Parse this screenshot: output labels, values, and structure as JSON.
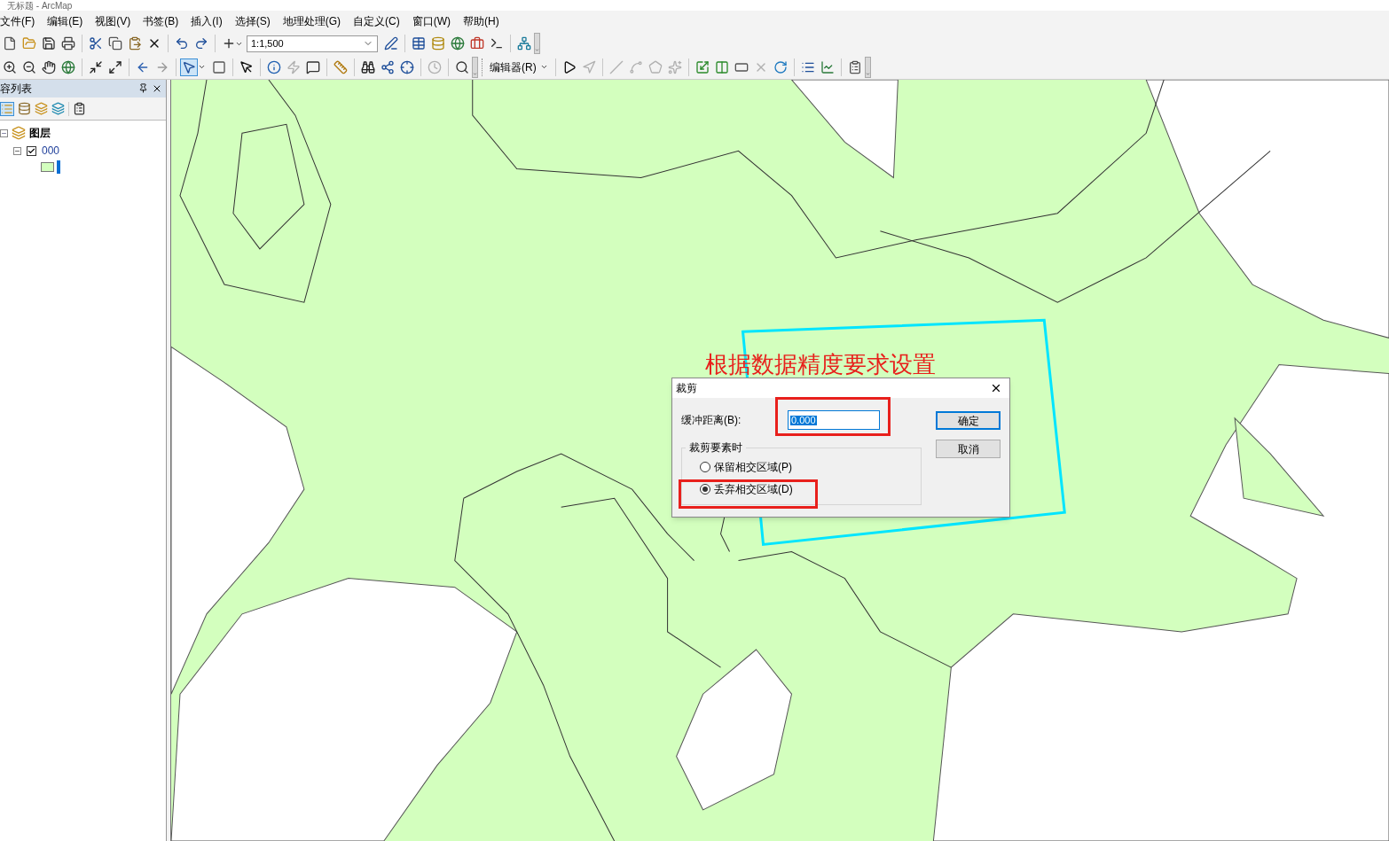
{
  "window": {
    "title": "无标题 - ArcMap"
  },
  "menu": [
    "文件(F)",
    "编辑(E)",
    "视图(V)",
    "书签(B)",
    "插入(I)",
    "选择(S)",
    "地理处理(G)",
    "自定义(C)",
    "窗口(W)",
    "帮助(H)"
  ],
  "scale_field": {
    "value": "1:1,500"
  },
  "editor_menu": {
    "label": "编辑器(R)"
  },
  "toc": {
    "title": "容列表",
    "root": {
      "label": "图层",
      "expanded": true,
      "children": [
        {
          "label": "000",
          "checked": true,
          "expanded": true
        }
      ]
    }
  },
  "annotation": "根据数据精度要求设置",
  "dialog": {
    "title": "裁剪",
    "buffer_label": "缓冲距离(B):",
    "buffer_value": "0.000",
    "ok": "确定",
    "cancel": "取消",
    "group_label": "裁剪要素时",
    "options": [
      {
        "label": "保留相交区域(P)",
        "selected": false
      },
      {
        "label": "丢弃相交区域(D)",
        "selected": true
      }
    ]
  }
}
